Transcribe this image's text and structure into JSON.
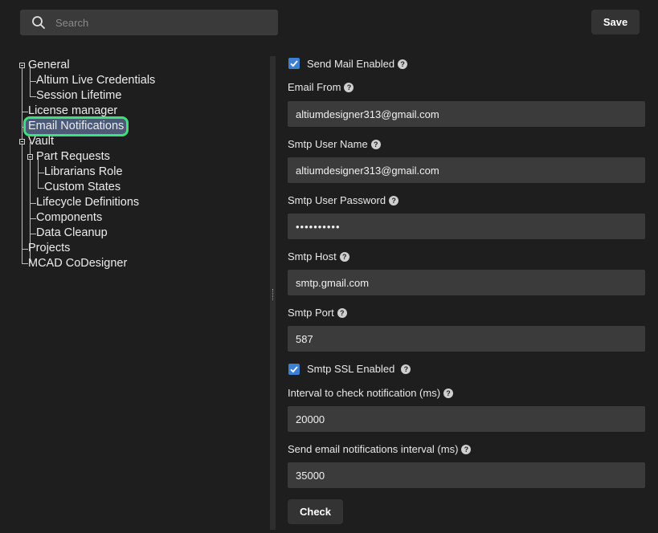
{
  "search": {
    "placeholder": "Search",
    "icon": "search-icon"
  },
  "toolbar": {
    "save_label": "Save"
  },
  "tree": {
    "general": "General",
    "altium_live_credentials": "Altium Live Credentials",
    "session_lifetime": "Session Lifetime",
    "license_manager": "License manager",
    "email_notifications": "Email Notifications",
    "vault": "Vault",
    "part_requests": "Part Requests",
    "librarians_role": "Librarians Role",
    "custom_states": "Custom States",
    "lifecycle_definitions": "Lifecycle Definitions",
    "components": "Components",
    "data_cleanup": "Data Cleanup",
    "projects": "Projects",
    "mcad_codesigner": "MCAD CoDesigner",
    "selected": "Email Notifications"
  },
  "form": {
    "send_mail_enabled": {
      "label": "Send Mail Enabled",
      "checked": true
    },
    "email_from": {
      "label": "Email From",
      "value": "altiumdesigner313@gmail.com"
    },
    "smtp_user_name": {
      "label": "Smtp User Name",
      "value": "altiumdesigner313@gmail.com"
    },
    "smtp_user_password": {
      "label": "Smtp User Password",
      "value": "••••••••••"
    },
    "smtp_host": {
      "label": "Smtp Host",
      "value": "smtp.gmail.com"
    },
    "smtp_port": {
      "label": "Smtp Port",
      "value": "587"
    },
    "smtp_ssl_enabled": {
      "label": "Smtp SSL Enabled",
      "checked": true
    },
    "interval_check": {
      "label": "Interval to check notification (ms)",
      "value": "20000"
    },
    "send_interval": {
      "label": "Send email notifications interval (ms)",
      "value": "35000"
    },
    "check_label": "Check",
    "help_glyph": "?"
  },
  "colors": {
    "background": "#1e1e1e",
    "field": "#3b3b3b",
    "checkbox": "#3d7fd0",
    "highlight": "#3fe07a",
    "selection": "#4a5a78"
  }
}
